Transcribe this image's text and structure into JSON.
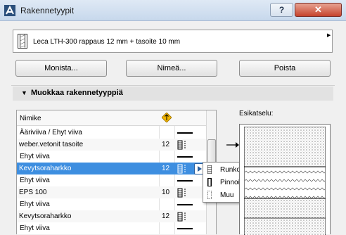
{
  "window": {
    "title": "Rakennetyypit",
    "help_label": "?",
    "close_label": "✕"
  },
  "selected_type": {
    "label": "Leca LTH-300 rappaus 12 mm + tasoite 10 mm",
    "arrow": "▶"
  },
  "buttons": {
    "copy": "Monista...",
    "rename": "Nimeä...",
    "delete": "Poista"
  },
  "section": {
    "arrow": "▼",
    "title": "Muokkaa rakennetyyppiä"
  },
  "table": {
    "header_name": "Nimike",
    "rows": [
      {
        "name": "Ääriviiva / Ehyt viiva",
        "num": "",
        "kind": "line"
      },
      {
        "name": "weber.vetonit tasoite",
        "num": "12",
        "kind": "fill"
      },
      {
        "name": "Ehyt viiva",
        "num": "",
        "kind": "line"
      },
      {
        "name": "Kevytsoraharkko",
        "num": "12",
        "kind": "fill",
        "selected": true
      },
      {
        "name": "Ehyt viiva",
        "num": "",
        "kind": "line"
      },
      {
        "name": "EPS 100",
        "num": "10",
        "kind": "fill"
      },
      {
        "name": "Ehyt viiva",
        "num": "",
        "kind": "line"
      },
      {
        "name": "Kevytsoraharkko",
        "num": "12",
        "kind": "fill"
      },
      {
        "name": "Ehyt viiva",
        "num": "",
        "kind": "line"
      }
    ]
  },
  "popup_menu": {
    "items": [
      "Runko",
      "Pinnoite",
      "Muu"
    ]
  },
  "preview": {
    "label": "Esikatselu:"
  },
  "colors": {
    "selection": "#3d8ee0",
    "close": "#c5432d"
  },
  "icons": [
    "archicad-app-icon",
    "priority-icon",
    "fill-icon",
    "line-icon",
    "arrow-icon"
  ]
}
